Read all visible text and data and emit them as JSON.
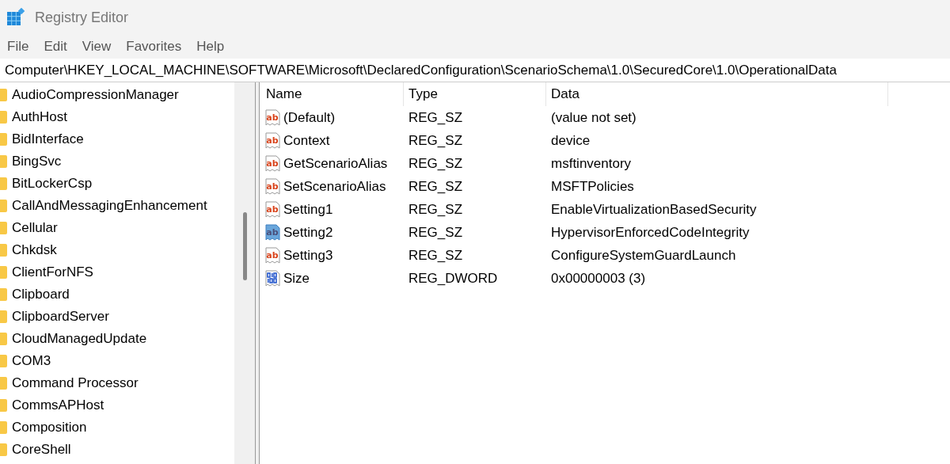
{
  "window": {
    "title": "Registry Editor"
  },
  "menu": [
    "File",
    "Edit",
    "View",
    "Favorites",
    "Help"
  ],
  "address": "Computer\\HKEY_LOCAL_MACHINE\\SOFTWARE\\Microsoft\\DeclaredConfiguration\\ScenarioSchema\\1.0\\SecuredCore\\1.0\\OperationalData",
  "tree": {
    "items": [
      "AudioCompressionManager",
      "AuthHost",
      "BidInterface",
      "BingSvc",
      "BitLockerCsp",
      "CallAndMessagingEnhancement",
      "Cellular",
      "Chkdsk",
      "ClientForNFS",
      "Clipboard",
      "ClipboardServer",
      "CloudManagedUpdate",
      "COM3",
      "Command Processor",
      "CommsAPHost",
      "Composition",
      "CoreShell"
    ]
  },
  "table": {
    "columns": [
      "Name",
      "Type",
      "Data"
    ],
    "rows": [
      {
        "kind": "string",
        "icon_label": "ab",
        "name": "(Default)",
        "type": "REG_SZ",
        "data": "(value not set)",
        "selected": false
      },
      {
        "kind": "string",
        "icon_label": "ab",
        "name": "Context",
        "type": "REG_SZ",
        "data": "device",
        "selected": false
      },
      {
        "kind": "string",
        "icon_label": "ab",
        "name": "GetScenarioAlias",
        "type": "REG_SZ",
        "data": "msftinventory",
        "selected": false
      },
      {
        "kind": "string",
        "icon_label": "ab",
        "name": "SetScenarioAlias",
        "type": "REG_SZ",
        "data": "MSFTPolicies",
        "selected": false
      },
      {
        "kind": "string",
        "icon_label": "ab",
        "name": "Setting1",
        "type": "REG_SZ",
        "data": "EnableVirtualizationBasedSecurity",
        "selected": false
      },
      {
        "kind": "string",
        "icon_label": "ab",
        "name": "Setting2",
        "type": "REG_SZ",
        "data": "HypervisorEnforcedCodeIntegrity",
        "selected": true
      },
      {
        "kind": "string",
        "icon_label": "ab",
        "name": "Setting3",
        "type": "REG_SZ",
        "data": "ConfigureSystemGuardLaunch",
        "selected": false
      },
      {
        "kind": "binary",
        "name": "Size",
        "type": "REG_DWORD",
        "data": "0x00000003 (3)",
        "selected": false
      }
    ]
  }
}
